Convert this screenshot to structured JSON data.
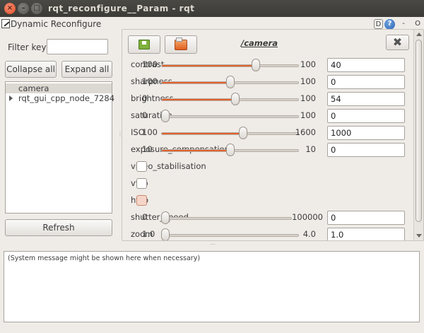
{
  "window": {
    "title": "rqt_reconfigure__Param - rqt",
    "close_glyph": "×",
    "min_glyph": "–",
    "max_glyph": "□"
  },
  "plugin": {
    "title": "Dynamic Reconfigure",
    "icon": "edit-icon",
    "d_label": "D",
    "help_label": "?",
    "dash_label": "-",
    "o_label": "O"
  },
  "filter": {
    "label": "Filter key:",
    "value": "",
    "placeholder": ""
  },
  "buttons": {
    "collapse_all": "Collapse all",
    "expand_all": "Expand all",
    "refresh": "Refresh"
  },
  "tree": {
    "items": [
      {
        "label": "camera",
        "selected": true,
        "has_children": false
      },
      {
        "label": "rqt_gui_cpp_node_7284",
        "selected": false,
        "has_children": true
      }
    ]
  },
  "config": {
    "namespace": "/camera",
    "save_icon": "save-icon",
    "open_icon": "folder-open-icon",
    "close_glyph": "✖",
    "params": [
      {
        "type": "slider",
        "name": "contrast",
        "min": "100",
        "max": "100",
        "value": "40",
        "level": 0.7
      },
      {
        "type": "slider",
        "name": "sharpness",
        "min": "100",
        "max": "100",
        "value": "0",
        "level": 0.5
      },
      {
        "type": "slider",
        "name": "brightness",
        "min": "0",
        "max": "100",
        "value": "54",
        "level": 0.54
      },
      {
        "type": "slider",
        "name": "saturation",
        "min": "0",
        "max": "100",
        "value": "0",
        "level": 0.0
      },
      {
        "type": "slider",
        "name": "ISO",
        "min": "100",
        "max": "1600",
        "value": "1000",
        "level": 0.6
      },
      {
        "type": "slider",
        "name": "exposure_compensation",
        "min": "10",
        "max": "10",
        "value": "0",
        "level": 0.5
      },
      {
        "type": "check",
        "name": "video_stabilisation",
        "checked": false,
        "hover": false
      },
      {
        "type": "check",
        "name": "vflip",
        "checked": false,
        "hover": false
      },
      {
        "type": "check",
        "name": "hflip",
        "checked": false,
        "hover": true
      },
      {
        "type": "slider",
        "name": "shutter_speed",
        "min": "0",
        "max": "100000",
        "value": "0",
        "level": 0.0
      },
      {
        "type": "slider",
        "name": "zoom",
        "min": "1.0",
        "max": "4.0",
        "value": "1.0",
        "level": 0.0
      }
    ]
  },
  "system_message": "(System message might be shown here when necessary)",
  "colors": {
    "slider_fill": "#e2622c",
    "title_bar": "#3c3b37",
    "window_bg": "#efebe7"
  }
}
